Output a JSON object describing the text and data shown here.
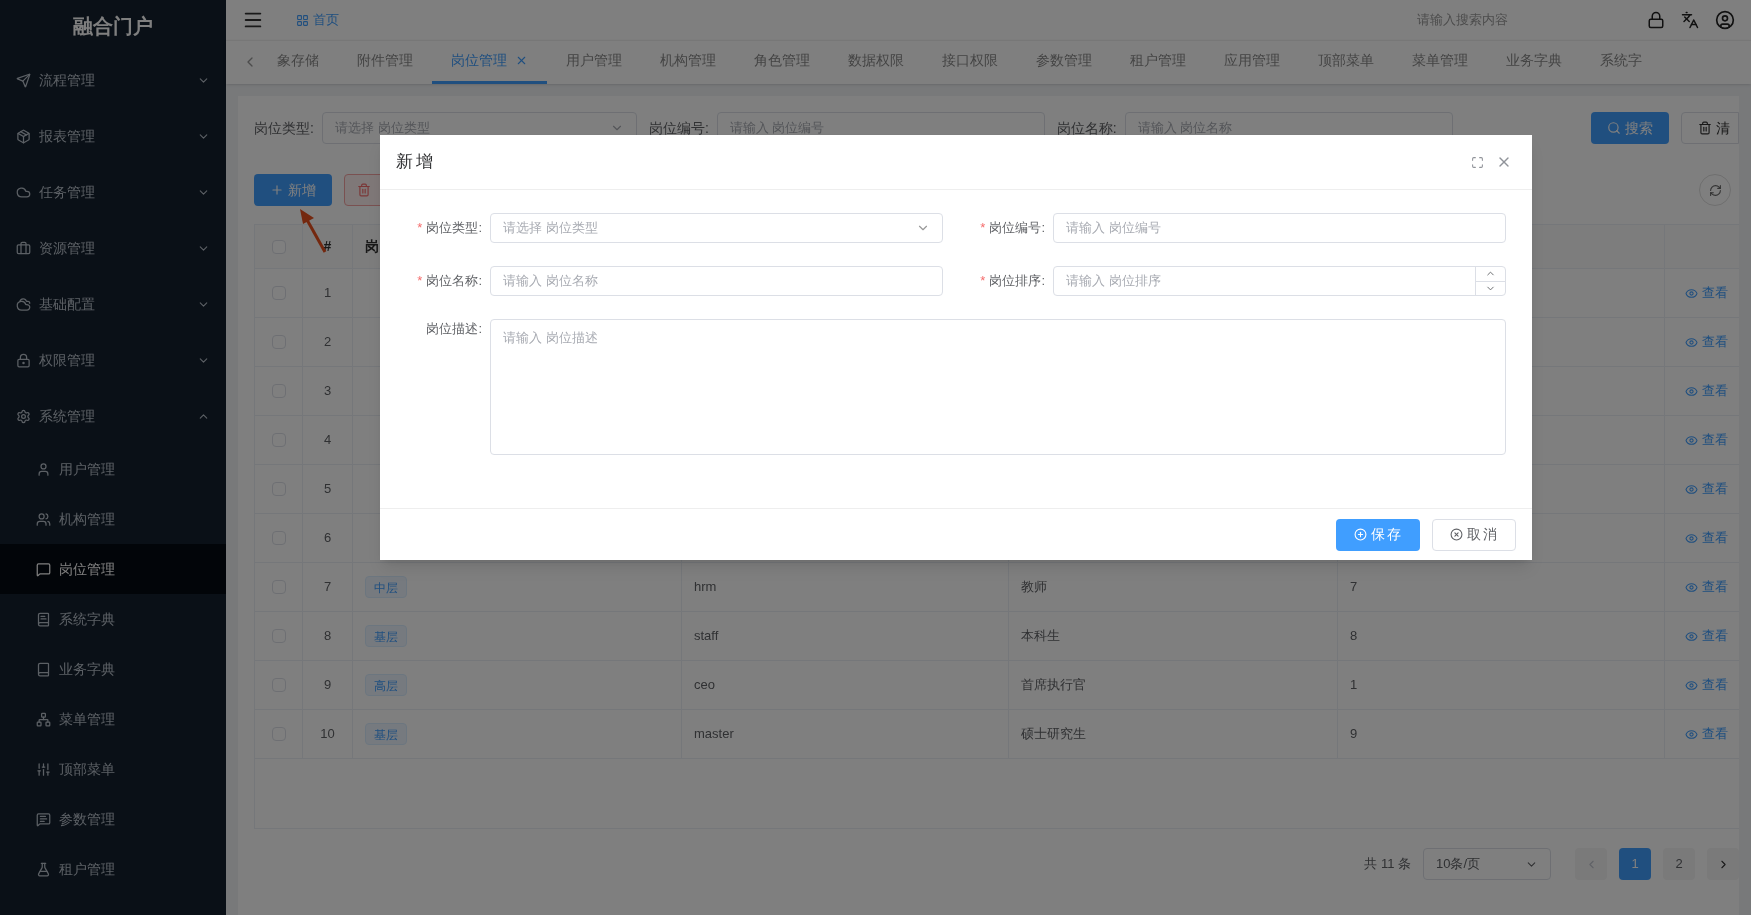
{
  "sidebar": {
    "title": "融合门户",
    "items": [
      {
        "label": "流程管理",
        "expanded": false,
        "selected": false
      },
      {
        "label": "报表管理",
        "expanded": false,
        "selected": false
      },
      {
        "label": "任务管理",
        "expanded": false,
        "selected": false
      },
      {
        "label": "资源管理",
        "expanded": false,
        "selected": false
      },
      {
        "label": "基础配置",
        "expanded": false,
        "selected": false
      },
      {
        "label": "权限管理",
        "expanded": false,
        "selected": false
      },
      {
        "label": "系统管理",
        "expanded": true,
        "selected": false,
        "children": [
          {
            "label": "用户管理",
            "selected": false
          },
          {
            "label": "机构管理",
            "selected": false
          },
          {
            "label": "岗位管理",
            "selected": true
          },
          {
            "label": "系统字典",
            "selected": false
          },
          {
            "label": "业务字典",
            "selected": false
          },
          {
            "label": "菜单管理",
            "selected": false
          },
          {
            "label": "顶部菜单",
            "selected": false
          },
          {
            "label": "参数管理",
            "selected": false
          },
          {
            "label": "租户管理",
            "selected": false
          }
        ]
      }
    ]
  },
  "topbar": {
    "home": "首页",
    "search_placeholder": "请输入搜索内容"
  },
  "tabs": [
    {
      "label": "象存储",
      "selected": false
    },
    {
      "label": "附件管理",
      "selected": false
    },
    {
      "label": "岗位管理",
      "selected": true
    },
    {
      "label": "用户管理",
      "selected": false
    },
    {
      "label": "机构管理",
      "selected": false
    },
    {
      "label": "角色管理",
      "selected": false
    },
    {
      "label": "数据权限",
      "selected": false
    },
    {
      "label": "接口权限",
      "selected": false
    },
    {
      "label": "参数管理",
      "selected": false
    },
    {
      "label": "租户管理",
      "selected": false
    },
    {
      "label": "应用管理",
      "selected": false
    },
    {
      "label": "顶部菜单",
      "selected": false
    },
    {
      "label": "菜单管理",
      "selected": false
    },
    {
      "label": "业务字典",
      "selected": false
    },
    {
      "label": "系统字",
      "selected": false
    }
  ],
  "search_form": {
    "fields": [
      {
        "label": "岗位类型:",
        "placeholder": "请选择 岗位类型",
        "kind": "select"
      },
      {
        "label": "岗位编号:",
        "placeholder": "请输入 岗位编号",
        "kind": "input"
      },
      {
        "label": "岗位名称:",
        "placeholder": "请输入 岗位名称",
        "kind": "input"
      }
    ],
    "search_button": "搜索",
    "clear_button": "清"
  },
  "toolbar": {
    "add_button": "新增"
  },
  "table": {
    "select_all": {
      "checked": false
    },
    "columns": [
      "#",
      "岗"
    ],
    "rows": [
      {
        "index": "1",
        "checked": false,
        "action": "查看"
      },
      {
        "index": "2",
        "checked": false,
        "action": "查看"
      },
      {
        "index": "3",
        "checked": false,
        "action": "查看"
      },
      {
        "index": "4",
        "checked": false,
        "action": "查看"
      },
      {
        "index": "5",
        "checked": false,
        "action": "查看"
      },
      {
        "index": "6",
        "checked": false,
        "action": "查看"
      },
      {
        "index": "7",
        "checked": false,
        "type": "中层",
        "code": "hrm",
        "name": "教师",
        "sort": "7",
        "action": "查看"
      },
      {
        "index": "8",
        "checked": false,
        "type": "基层",
        "code": "staff",
        "name": "本科生",
        "sort": "8",
        "action": "查看"
      },
      {
        "index": "9",
        "checked": false,
        "type": "高层",
        "code": "ceo",
        "name": "首席执行官",
        "sort": "1",
        "action": "查看"
      },
      {
        "index": "10",
        "checked": false,
        "type": "基层",
        "code": "master",
        "name": "硕士研究生",
        "sort": "9",
        "action": "查看"
      }
    ]
  },
  "pagination": {
    "total": "共 11 条",
    "page_size": "10条/页",
    "pages": [
      {
        "label": "1",
        "selected": true
      },
      {
        "label": "2",
        "selected": false
      }
    ]
  },
  "dialog": {
    "title": "新增",
    "fields": [
      {
        "label": "岗位类型:",
        "placeholder": "请选择 岗位类型",
        "kind": "select",
        "required": true
      },
      {
        "label": "岗位编号:",
        "placeholder": "请输入 岗位编号",
        "kind": "input",
        "required": true
      },
      {
        "label": "岗位名称:",
        "placeholder": "请输入 岗位名称",
        "kind": "input",
        "required": true
      },
      {
        "label": "岗位排序:",
        "placeholder": "请输入 岗位排序",
        "kind": "number",
        "required": true
      },
      {
        "label": "岗位描述:",
        "placeholder": "请输入 岗位描述",
        "kind": "textarea",
        "required": false
      }
    ],
    "required_mark": "*",
    "save_button": "保存",
    "cancel_button": "取消"
  }
}
